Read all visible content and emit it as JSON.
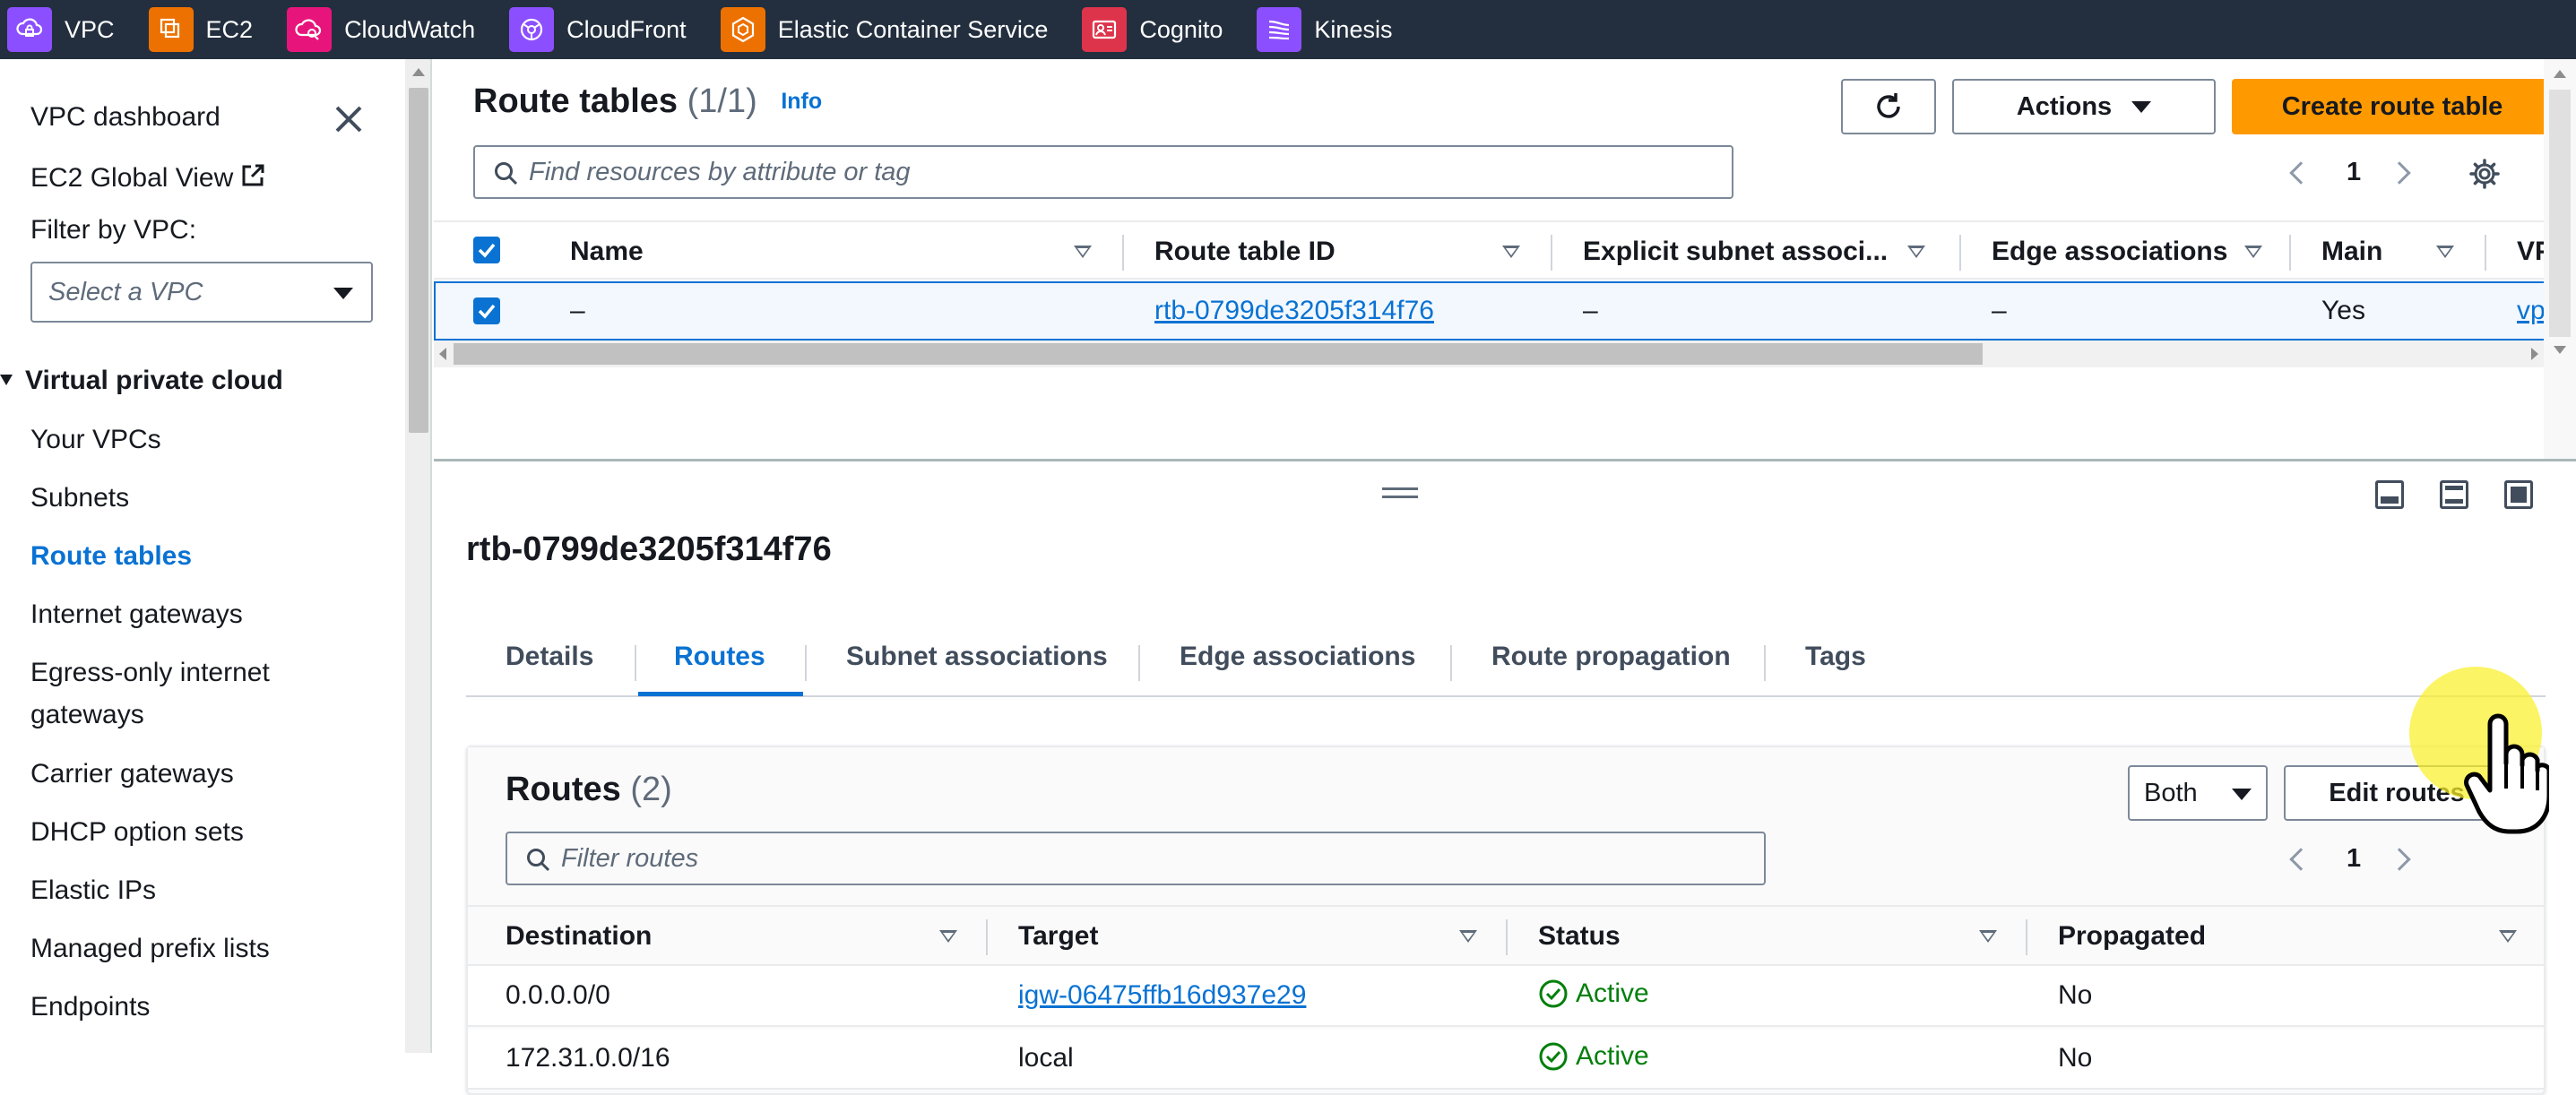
{
  "topbar": {
    "favorites": [
      {
        "label": "VPC",
        "icon": "vpc-icon",
        "color": "#8c4fff"
      },
      {
        "label": "EC2",
        "icon": "ec2-icon",
        "color": "#ed7100"
      },
      {
        "label": "CloudWatch",
        "icon": "cloudwatch-icon",
        "color": "#e7157b"
      },
      {
        "label": "CloudFront",
        "icon": "cloudfront-icon",
        "color": "#8c4fff"
      },
      {
        "label": "Elastic Container Service",
        "icon": "ecs-icon",
        "color": "#ed7100"
      },
      {
        "label": "Cognito",
        "icon": "cognito-icon",
        "color": "#dd344c"
      },
      {
        "label": "Kinesis",
        "icon": "kinesis-icon",
        "color": "#8c4fff"
      }
    ]
  },
  "sidebar": {
    "dashboard": "VPC dashboard",
    "global_view": "EC2 Global View",
    "filter_label": "Filter by VPC:",
    "filter_placeholder": "Select a VPC",
    "section": "Virtual private cloud",
    "items": [
      "Your VPCs",
      "Subnets",
      "Route tables",
      "Internet gateways",
      "Egress-only internet",
      "gateways",
      "Carrier gateways",
      "DHCP option sets",
      "Elastic IPs",
      "Managed prefix lists",
      "Endpoints"
    ],
    "active_item": "Route tables"
  },
  "route_tables": {
    "title": "Route tables",
    "count": "(1/1)",
    "info": "Info",
    "actions_label": "Actions",
    "create_label": "Create route table",
    "search_placeholder": "Find resources by attribute or tag",
    "page": "1",
    "columns": [
      "Name",
      "Route table ID",
      "Explicit subnet associ...",
      "Edge associations",
      "Main",
      "VP"
    ],
    "row": {
      "name": "–",
      "route_table_id": "rtb-0799de3205f314f76",
      "explicit_subnet": "–",
      "edge_associations": "–",
      "main": "Yes",
      "vpc": "vp"
    }
  },
  "detail": {
    "title": "rtb-0799de3205f314f76",
    "tabs": [
      "Details",
      "Routes",
      "Subnet associations",
      "Edge associations",
      "Route propagation",
      "Tags"
    ],
    "active_tab": "Routes"
  },
  "routes": {
    "title": "Routes",
    "count": "(2)",
    "filter_value": "Both",
    "edit_label": "Edit routes",
    "search_placeholder": "Filter routes",
    "page": "1",
    "columns": [
      "Destination",
      "Target",
      "Status",
      "Propagated"
    ],
    "rows": [
      {
        "destination": "0.0.0.0/0",
        "target": "igw-06475ffb16d937e29",
        "status": "Active",
        "propagated": "No"
      },
      {
        "destination": "172.31.0.0/16",
        "target": "local",
        "status": "Active",
        "propagated": "No"
      }
    ]
  },
  "colors": {
    "nav_bg": "#232f3e",
    "link": "#0972d3",
    "primary": "#ff9900",
    "success": "#037f0c"
  }
}
